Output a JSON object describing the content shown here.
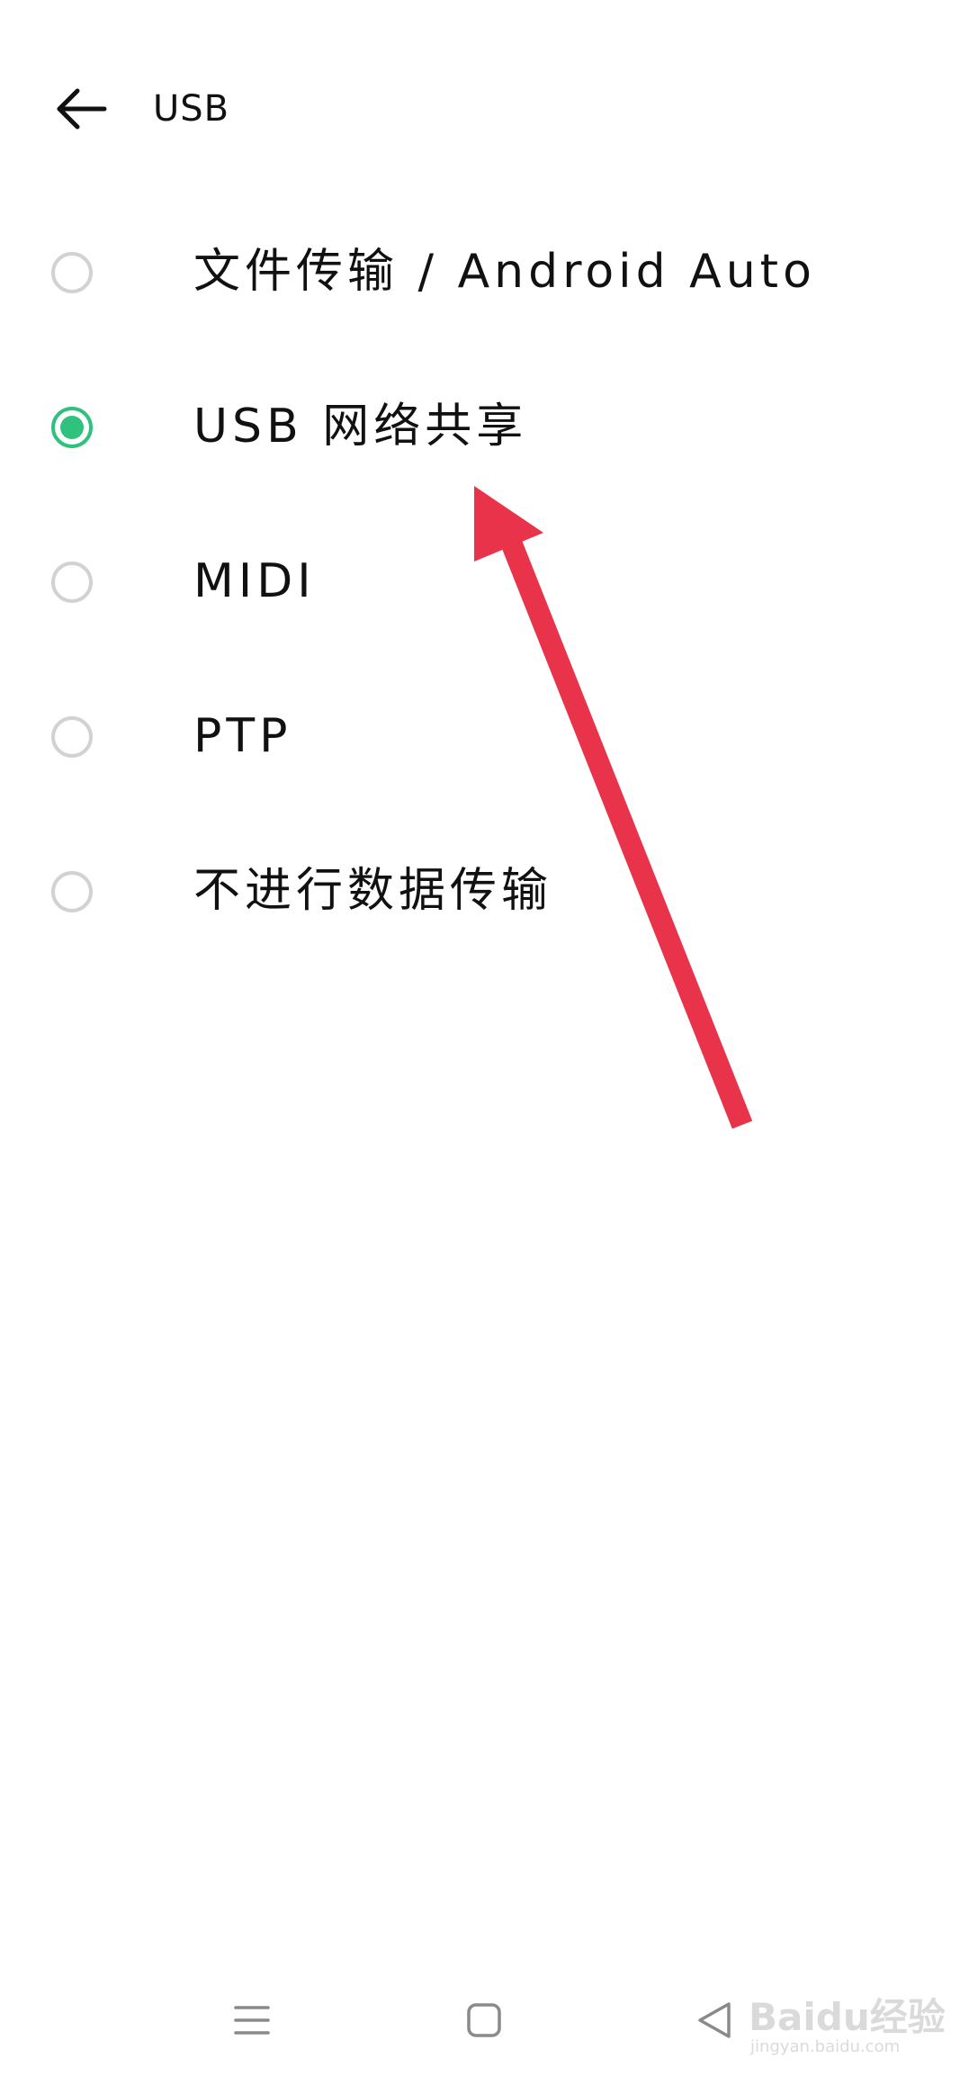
{
  "header": {
    "back_icon": "arrow-left-icon",
    "title": "USB"
  },
  "options": [
    {
      "label": "文件传输 / Android Auto",
      "selected": false
    },
    {
      "label": "USB 网络共享",
      "selected": true
    },
    {
      "label": "MIDI",
      "selected": false
    },
    {
      "label": "PTP",
      "selected": false
    },
    {
      "label": "不进行数据传输",
      "selected": false
    }
  ],
  "colors": {
    "accent": "#2ec27e",
    "radio_border": "#d2d2d2",
    "annotation_arrow": "#e8334a"
  },
  "navbar": {
    "menu_icon": "menu-icon",
    "home_icon": "home-square-icon",
    "back_icon": "back-triangle-icon"
  },
  "watermark": {
    "text": "Baidu经验",
    "subtext": "jingyan.baidu.com"
  }
}
